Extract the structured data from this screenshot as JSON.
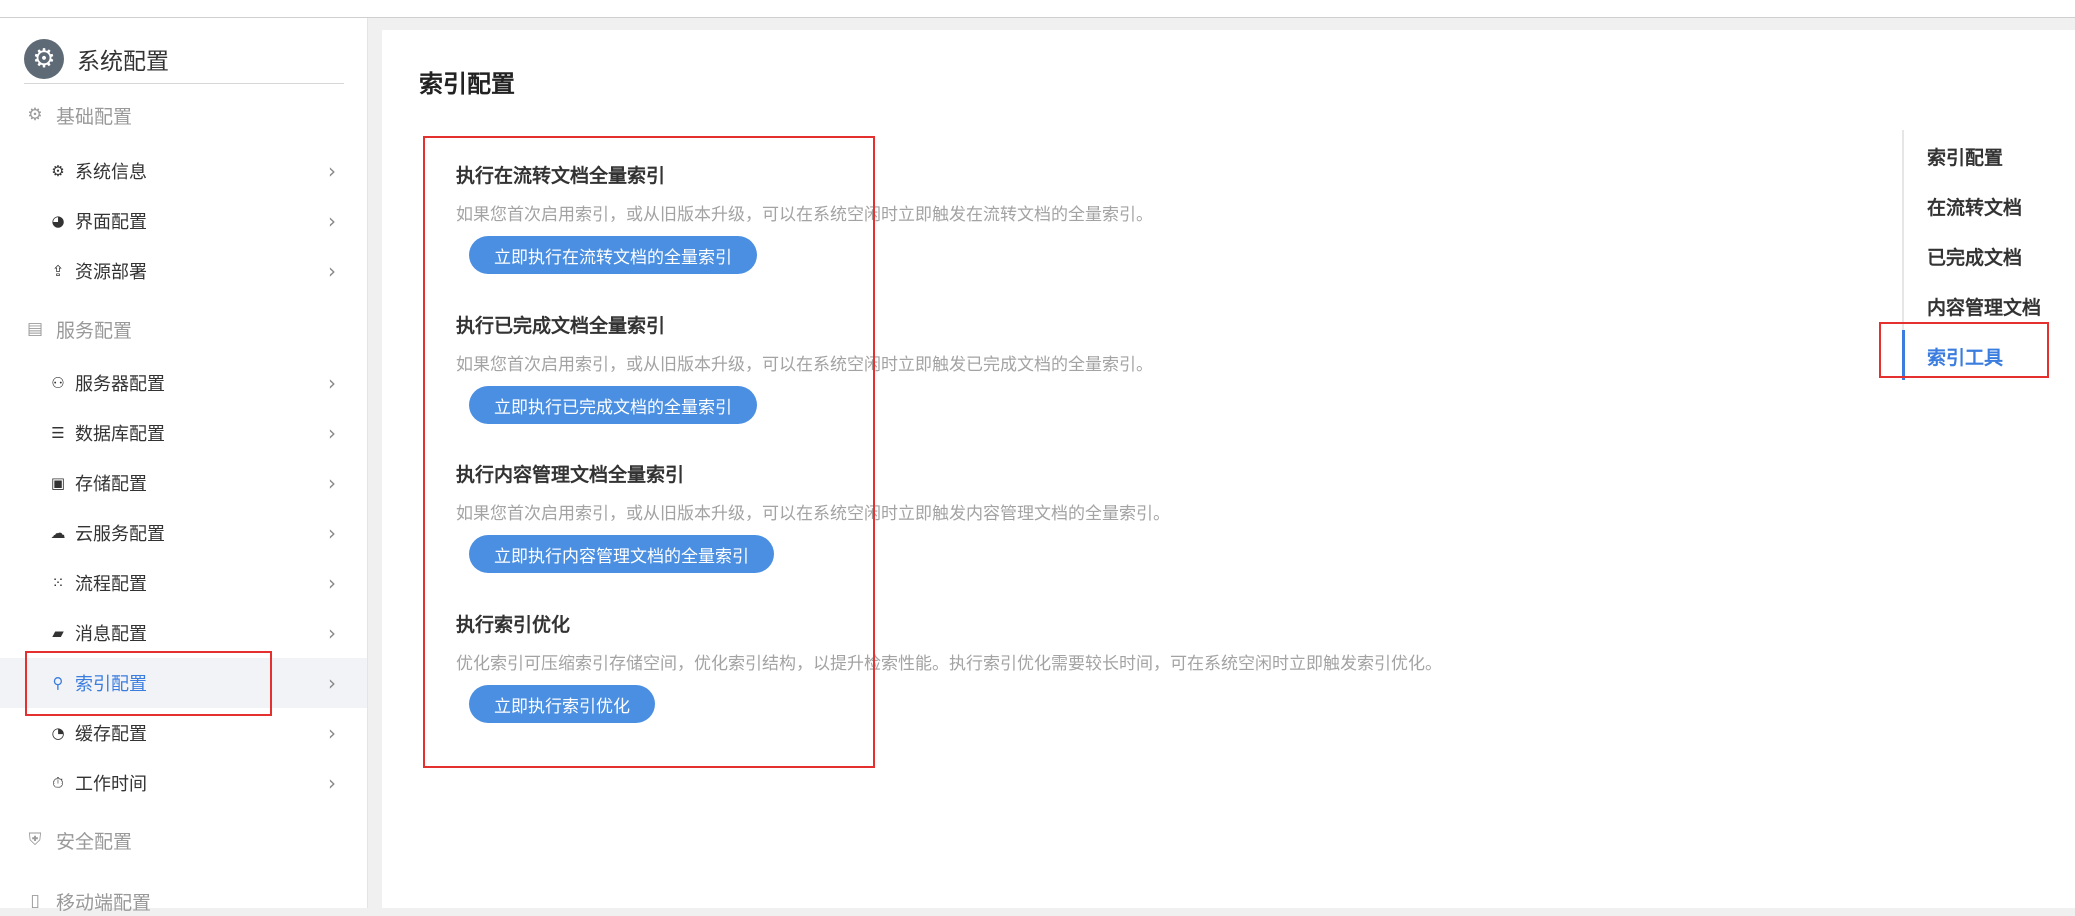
{
  "sidebar": {
    "title": "系统配置",
    "logo_icon": "gear-icon",
    "groups": [
      {
        "label": "基础配置",
        "icon": "gear-icon"
      },
      {
        "label": "服务配置",
        "icon": "services-icon"
      },
      {
        "label": "安全配置",
        "icon": "shield-icon"
      },
      {
        "label": "移动端配置",
        "icon": "mobile-icon"
      }
    ],
    "items": [
      {
        "label": "系统信息",
        "icon": "gear-icon"
      },
      {
        "label": "界面配置",
        "icon": "palette-icon"
      },
      {
        "label": "资源部署",
        "icon": "upload-icon"
      },
      {
        "label": "服务器配置",
        "icon": "server-icon"
      },
      {
        "label": "数据库配置",
        "icon": "database-icon"
      },
      {
        "label": "存储配置",
        "icon": "archive-icon"
      },
      {
        "label": "云服务配置",
        "icon": "cloud-icon"
      },
      {
        "label": "流程配置",
        "icon": "flow-icon"
      },
      {
        "label": "消息配置",
        "icon": "message-icon"
      },
      {
        "label": "索引配置",
        "icon": "search-icon",
        "active": true
      },
      {
        "label": "缓存配置",
        "icon": "pie-icon"
      },
      {
        "label": "工作时间",
        "icon": "stopwatch-icon"
      }
    ]
  },
  "main": {
    "title": "索引配置",
    "sections": [
      {
        "title": "执行在流转文档全量索引",
        "description": "如果您首次启用索引，或从旧版本升级，可以在系统空闲时立即触发在流转文档的全量索引。",
        "button": "立即执行在流转文档的全量索引"
      },
      {
        "title": "执行已完成文档全量索引",
        "description": "如果您首次启用索引，或从旧版本升级，可以在系统空闲时立即触发已完成文档的全量索引。",
        "button": "立即执行已完成文档的全量索引"
      },
      {
        "title": "执行内容管理文档全量索引",
        "description": "如果您首次启用索引，或从旧版本升级，可以在系统空闲时立即触发内容管理文档的全量索引。",
        "button": "立即执行内容管理文档的全量索引"
      },
      {
        "title": "执行索引优化",
        "description": "优化索引可压缩索引存储空间，优化索引结构，以提升检索性能。执行索引优化需要较长时间，可在系统空闲时立即触发索引优化。",
        "button": "立即执行索引优化"
      }
    ]
  },
  "right_nav": {
    "items": [
      "索引配置",
      "在流转文档",
      "已完成文档",
      "内容管理文档",
      "索引工具"
    ],
    "active": "索引工具"
  },
  "colors": {
    "accent": "#3b7ddf",
    "button": "#4a8fe2",
    "highlight_box": "#e4312f"
  }
}
